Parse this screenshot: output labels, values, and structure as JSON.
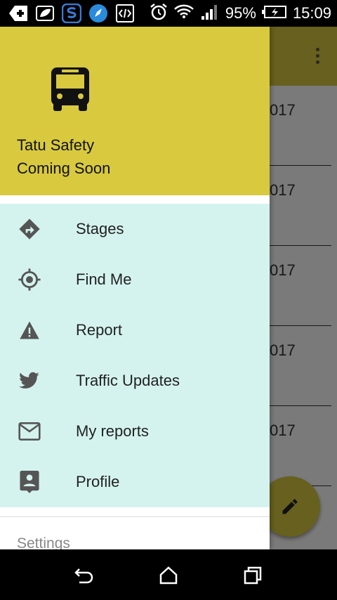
{
  "status_bar": {
    "battery": "95%",
    "time": "15:09"
  },
  "drawer": {
    "header": {
      "title": "Tatu Safety",
      "subtitle": "Coming Soon"
    },
    "items": [
      {
        "label": "Stages",
        "icon": "directions-icon"
      },
      {
        "label": "Find Me",
        "icon": "my-location-icon"
      },
      {
        "label": "Report",
        "icon": "warning-icon"
      },
      {
        "label": "Traffic Updates",
        "icon": "twitter-icon"
      },
      {
        "label": "My reports",
        "icon": "mail-icon"
      },
      {
        "label": "Profile",
        "icon": "account-box-icon"
      }
    ],
    "settings_label": "Settings"
  },
  "background_list": {
    "rows": [
      "017",
      "017",
      "017",
      "017",
      "017"
    ]
  },
  "colors": {
    "header": "#d8c93f",
    "menu_bg": "#d4f3ef",
    "icon": "#555555"
  }
}
